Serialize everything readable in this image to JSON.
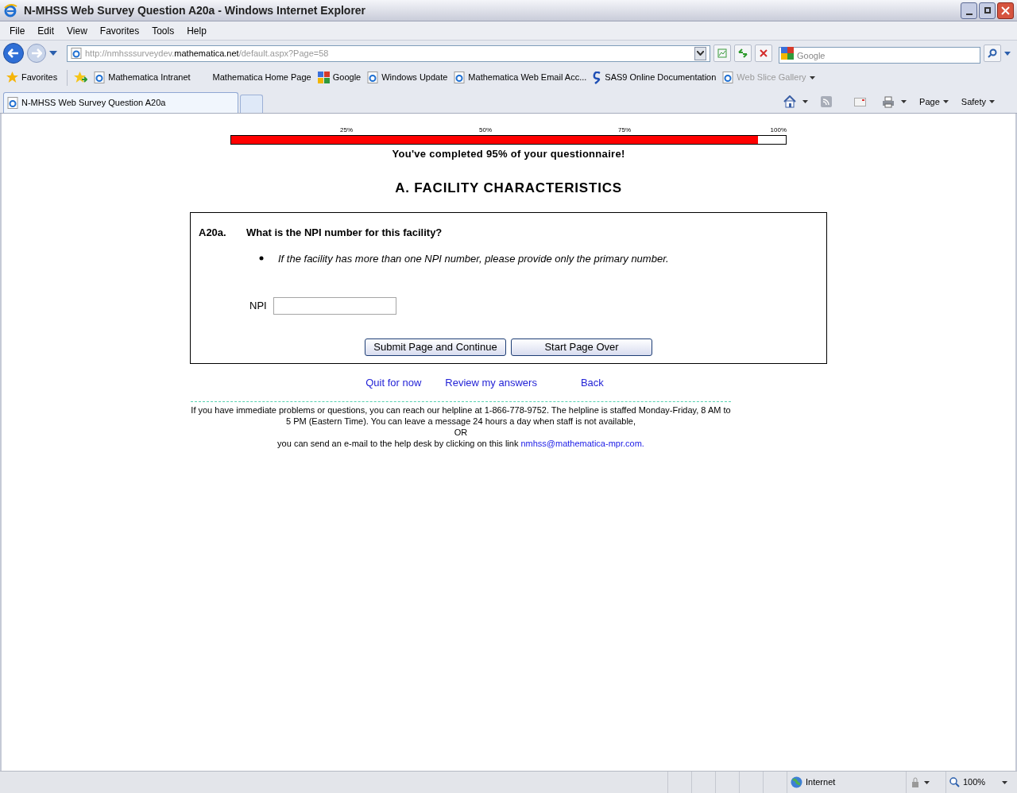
{
  "window": {
    "title": "N-MHSS Web Survey Question A20a - Windows Internet Explorer"
  },
  "menu": [
    "File",
    "Edit",
    "View",
    "Favorites",
    "Tools",
    "Help"
  ],
  "address": {
    "prefix": "http://nmhsssurveydev.",
    "domain": "mathematica.net",
    "path": "/default.aspx?Page=58"
  },
  "search": {
    "placeholder": "Google"
  },
  "favorites_bar": {
    "label": "Favorites",
    "items": [
      {
        "label": "Mathematica Intranet",
        "kind": "ie",
        "disabled": false
      },
      {
        "label": "Mathematica Home Page",
        "kind": "none",
        "disabled": false
      },
      {
        "label": "Google",
        "kind": "google",
        "disabled": false
      },
      {
        "label": "Windows Update",
        "kind": "ie",
        "disabled": false
      },
      {
        "label": "Mathematica Web Email Acc...",
        "kind": "ie",
        "disabled": false
      },
      {
        "label": "SAS9 Online Documentation",
        "kind": "sas",
        "disabled": false
      },
      {
        "label": "Web Slice Gallery",
        "kind": "ie",
        "disabled": true
      }
    ]
  },
  "tabs": [
    {
      "label": "N-MHSS Web Survey Question A20a",
      "selected": true
    }
  ],
  "command_bar": [
    "Page",
    "Safety"
  ],
  "progress": {
    "ticks": [
      "25%",
      "50%",
      "75%",
      "100%"
    ],
    "level": 0.95,
    "message": "You've completed 95% of your questionnaire!"
  },
  "section_title": "A. FACILITY CHARACTERISTICS",
  "question": {
    "number": "A20a.",
    "text": "What is the NPI number for this facility?",
    "note": "If the facility has more than one NPI number, please provide only the primary number.",
    "field_label": "NPI"
  },
  "buttons": [
    "Submit Page and Continue",
    "Start Page Over"
  ],
  "links": [
    "Quit for now",
    "Review my answers",
    "Back"
  ],
  "help": {
    "text": "If you have immediate problems or questions, you can reach our helpline at 1-866-778-9752. The helpline is staffed Monday-Friday, 8 AM to 5 PM (Eastern Time). You can leave a message 24 hours a day when staff is not available,",
    "or": "OR",
    "email_text": "you can send an e-mail to the help desk by clicking on this link",
    "email": "nmhss@mathematica-mpr.com."
  },
  "status_bar": {
    "zone": "Internet",
    "zoom": "100%"
  }
}
